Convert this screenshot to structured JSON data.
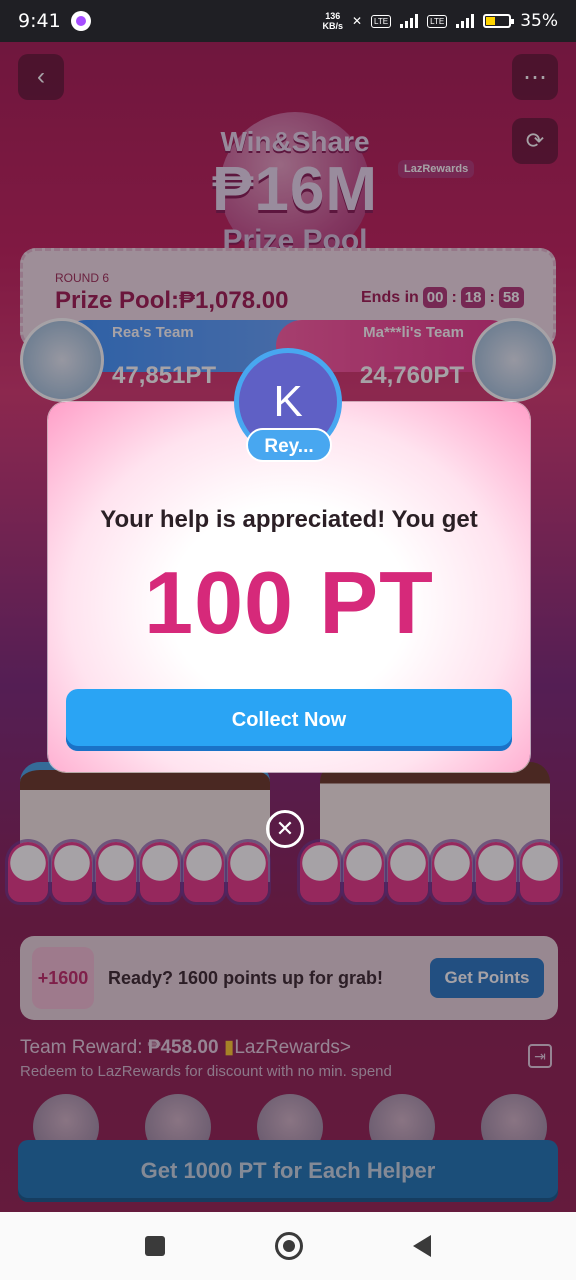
{
  "status": {
    "time": "9:41",
    "speed_top": "136",
    "speed_bottom": "KB/s",
    "battery": "35%"
  },
  "header": {
    "back_icon": "back-arrow-icon",
    "more_icon": "more-icon",
    "refresh_icon": "refresh-icon"
  },
  "banner": {
    "line1": "Win&Share",
    "line2": "₱16M",
    "line3": "Prize Pool",
    "brand": "LazRewards"
  },
  "round": {
    "label": "ROUND 6",
    "prize_pool": "Prize Pool:₱1,078.00",
    "ends_label": "Ends in",
    "timer": [
      "00",
      "18",
      "58"
    ]
  },
  "teams": {
    "left_name": "Rea's Team",
    "left_points": "47,851PT",
    "right_name": "Ma***li's Team",
    "right_points": "24,760PT"
  },
  "modal": {
    "avatar_letter": "K",
    "user_name": "Rey...",
    "message": "Your help is appreciated! You get",
    "points": "100 PT",
    "collect_label": "Collect Now"
  },
  "points_card": {
    "badge": "+1600",
    "text": "Ready? 1600 points up for grab!",
    "button": "Get Points"
  },
  "reward": {
    "title_prefix": "Team Reward: ",
    "amount": "₱458.00",
    "brand_link": "LazRewards>",
    "subtitle": "Redeem to LazRewards for discount with no min. spend"
  },
  "bottom_button": "Get 1000 PT for Each Helper",
  "colors": {
    "accent_pink": "#d6297a",
    "button_blue": "#2aa4f4"
  }
}
